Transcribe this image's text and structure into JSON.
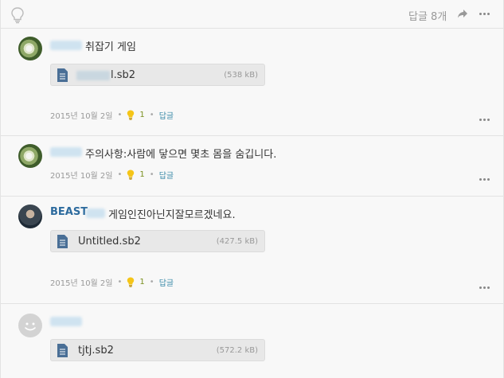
{
  "header": {
    "reply_count": "답글 8개"
  },
  "comments": [
    {
      "avatar": "flower-avatar",
      "author_visible": "",
      "text": "취잡기 게임",
      "attachment": {
        "name_suffix": "l.sb2",
        "size": "(538 kB)"
      },
      "date": "2015년 10월 2일",
      "likes": "1",
      "reply": "답글"
    },
    {
      "avatar": "flower-avatar",
      "author_visible": "",
      "text": "주의사항:사람에 닿으면 몇초 몸을 숨깁니다.",
      "date": "2015년 10월 2일",
      "likes": "1",
      "reply": "답글"
    },
    {
      "avatar": "person-avatar",
      "author_visible": "BEAST",
      "text": "게임인진아닌지잘모르겠네요.",
      "attachment": {
        "name": "Untitled.sb2",
        "size": "(427.5 kB)"
      },
      "date": "2015년 10월 2일",
      "likes": "1",
      "reply": "답글"
    },
    {
      "avatar": "default-smiley-avatar",
      "author_visible": "",
      "attachment": {
        "name": "tjtj.sb2",
        "size": "(572.2 kB)"
      }
    }
  ],
  "colors": {
    "accent_link": "#3a8aa8",
    "like_count": "#7a8f1f",
    "author_link": "#2d6b9e",
    "file_icon": "#4a6f96"
  }
}
